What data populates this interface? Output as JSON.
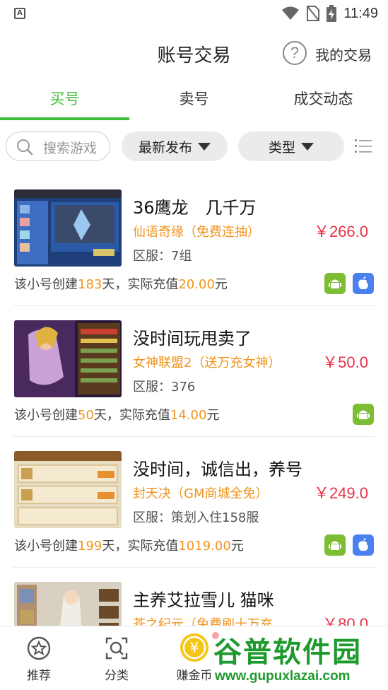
{
  "status_bar": {
    "time": "11:49",
    "app_icon_letter": "A"
  },
  "header": {
    "title": "账号交易",
    "help_icon": "question-circle-icon",
    "my_trade": "我的交易"
  },
  "tabs": [
    {
      "label": "买号",
      "active": true
    },
    {
      "label": "卖号",
      "active": false
    },
    {
      "label": "成交动态",
      "active": false
    }
  ],
  "filters": {
    "search_placeholder": "搜索游戏",
    "sort_label": "最新发布",
    "type_label": "类型",
    "list_icon": "list-icon"
  },
  "listings": [
    {
      "title": "36鹰龙　几千万",
      "game": "仙语奇缘（免费连抽）",
      "server": "区服：7组",
      "price": "￥266.0",
      "meta_prefix": "该小号创建",
      "days": "183",
      "meta_mid": "天，实际充值",
      "recharge": "20.00",
      "meta_suffix": "元",
      "android": true,
      "ios": true
    },
    {
      "title": "没时间玩甩卖了",
      "game": "女神联盟2（送万充女神）",
      "server": "区服：376",
      "price": "￥50.0",
      "meta_prefix": "该小号创建",
      "days": "50",
      "meta_mid": "天，实际充值",
      "recharge": "14.00",
      "meta_suffix": "元",
      "android": true,
      "ios": false
    },
    {
      "title": "没时间，诚信出，养号",
      "game": "封天决（GM商城全免）",
      "server": "区服：策划入住158服",
      "price": "￥249.0",
      "meta_prefix": "该小号创建",
      "days": "199",
      "meta_mid": "天，实际充值",
      "recharge": "1019.00",
      "meta_suffix": "元",
      "android": true,
      "ios": true
    },
    {
      "title": "主养艾拉雪儿 猫咪",
      "game": "苍之纪元（免费刷十万充",
      "server": "",
      "price": "￥80.0",
      "meta_prefix": "",
      "days": "",
      "meta_mid": "",
      "recharge": "",
      "meta_suffix": "",
      "android": false,
      "ios": false
    }
  ],
  "bottom_nav": [
    {
      "label": "推荐",
      "icon": "star-icon"
    },
    {
      "label": "分类",
      "icon": "search-icon"
    },
    {
      "label": "赚金币",
      "icon": "coin-icon"
    }
  ],
  "watermark": {
    "title": "谷普软件园",
    "url": "www.gupuxlazai.com"
  },
  "colors": {
    "accent": "#3fbd3a",
    "price": "#e8334a",
    "highlight": "#f0941e",
    "android": "#7cbd33",
    "ios": "#4a80f0"
  }
}
